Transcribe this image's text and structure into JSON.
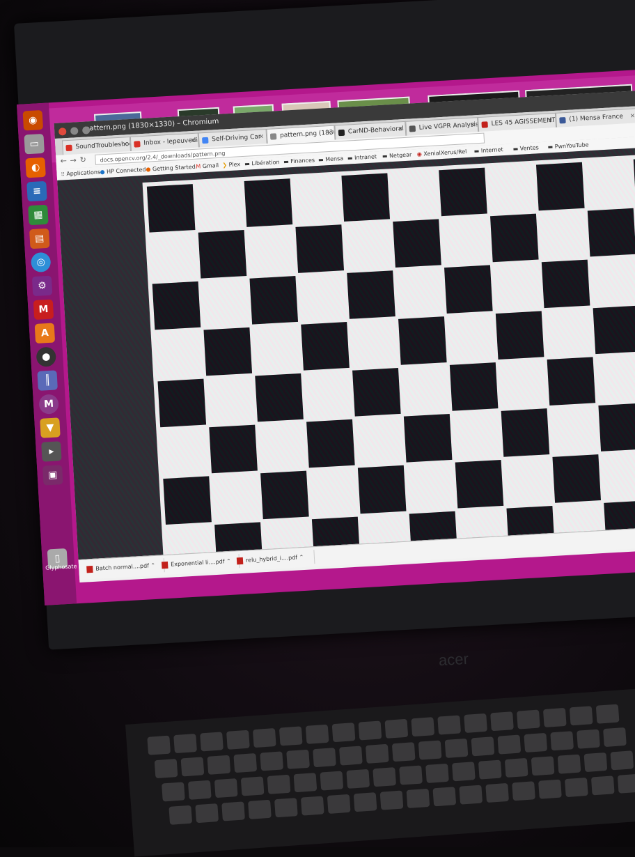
{
  "window": {
    "title": "pattern.png (1830×1330) – Chromium"
  },
  "tabs": [
    {
      "label": "SoundTroubleshoo",
      "color": "#d93025"
    },
    {
      "label": "Inbox - lepeuvedic",
      "color": "#d93025"
    },
    {
      "label": "Self-Driving Car",
      "color": "#4285f4"
    },
    {
      "label": "pattern.png (1830",
      "color": "#888888",
      "active": true
    },
    {
      "label": "CarND-Behavioral",
      "color": "#222222"
    },
    {
      "label": "Live VGPR Analysis",
      "color": "#555555"
    },
    {
      "label": "LES 45 AGISSEMENT",
      "color": "#c2211b"
    },
    {
      "label": "(1) Mensa France",
      "color": "#3b5998"
    }
  ],
  "url": "docs.opencv.org/2.4/_downloads/pattern.png",
  "bookmarks": [
    {
      "label": "Applications",
      "icon": "apps-grid-icon"
    },
    {
      "label": "HP Connected",
      "icon": "hp-icon"
    },
    {
      "label": "Getting Started",
      "icon": "firefox-icon"
    },
    {
      "label": "Gmail",
      "icon": "gmail-icon"
    },
    {
      "label": "Plex",
      "icon": "plex-icon"
    },
    {
      "label": "Libération",
      "icon": "folder-icon"
    },
    {
      "label": "Finances",
      "icon": "folder-icon"
    },
    {
      "label": "Mensa",
      "icon": "folder-icon"
    },
    {
      "label": "Intranet",
      "icon": "folder-icon"
    },
    {
      "label": "Netgear",
      "icon": "folder-icon"
    },
    {
      "label": "XenialXerus/Rel",
      "icon": "debian-icon"
    },
    {
      "label": "Internet",
      "icon": "folder-icon"
    },
    {
      "label": "Ventes",
      "icon": "folder-icon"
    },
    {
      "label": "PwnYouTube",
      "icon": "folder-icon"
    }
  ],
  "downloads": [
    {
      "label": "Batch normal....pdf"
    },
    {
      "label": "Exponential li....pdf"
    },
    {
      "label": "relu_hybrid_i....pdf"
    }
  ],
  "desktop": {
    "trash_label": "Glyphosate",
    "bezel_brand": "acer"
  },
  "launcher_icons": [
    "ubuntu-icon",
    "files-icon",
    "firefox-icon",
    "writer-icon",
    "calc-icon",
    "impress-icon",
    "chromium-icon",
    "settings-icon",
    "mendeley-icon",
    "software-center-icon",
    "camera-icon",
    "books-icon",
    "mendeley-m-icon",
    "ubuntu-store-icon",
    "terminal-icon",
    "workspaces-icon",
    "trash-icon"
  ],
  "colors": {
    "wallpaper": "#b4188c",
    "launcher": "#8a1570",
    "checker_dark": "#121216",
    "checker_light": "#f2f2f0"
  }
}
